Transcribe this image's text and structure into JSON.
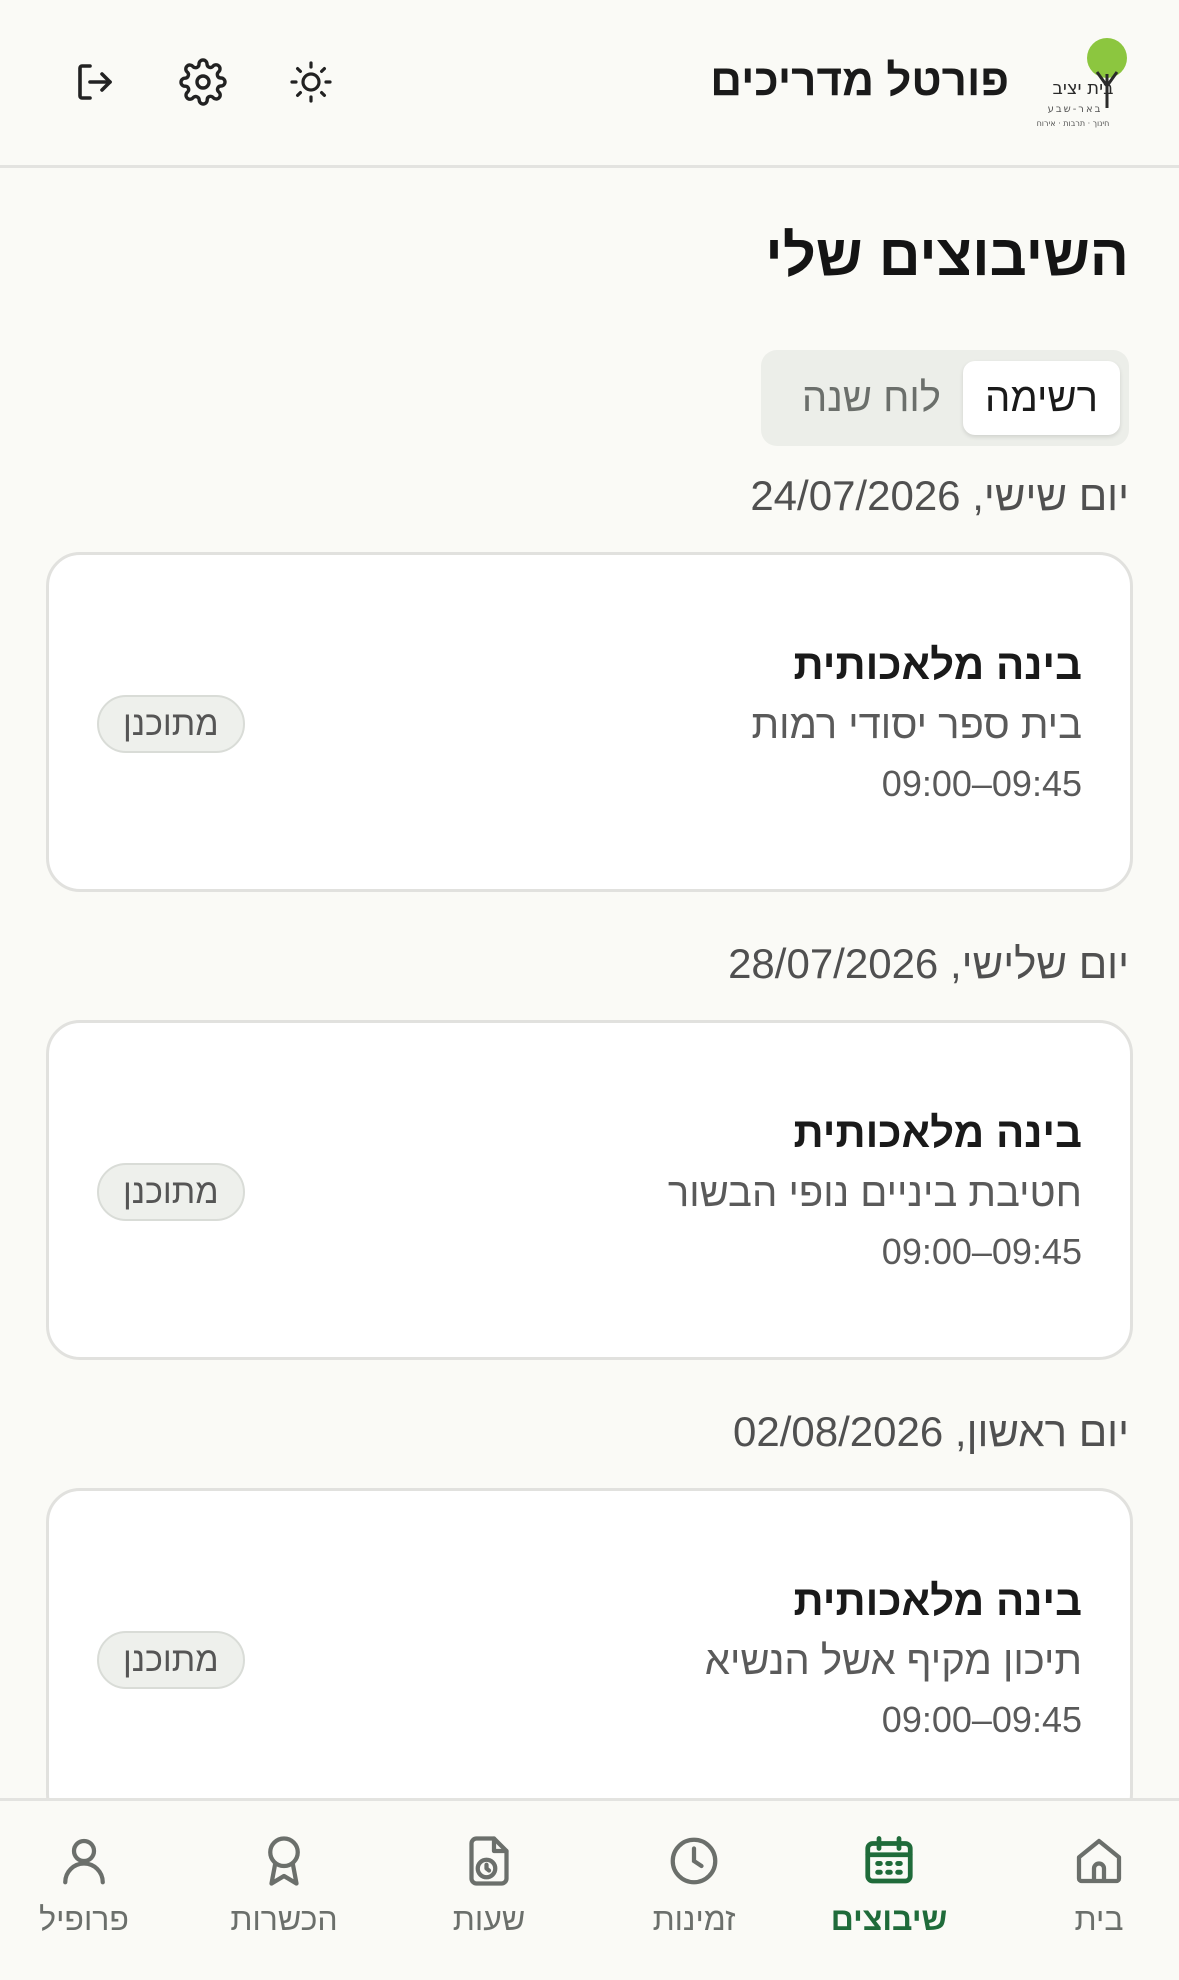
{
  "header": {
    "logo_text_main": "בית יציב",
    "logo_text_city": "באר-שבע",
    "logo_text_tagline": "חינוך · תרבות · אירוח",
    "title": "פורטל מדריכים",
    "icons": [
      "logout-icon",
      "gear-icon",
      "sun-icon"
    ]
  },
  "page": {
    "title": "השיבוצים שלי",
    "view_toggle": {
      "options": [
        "רשימה",
        "לוח שנה"
      ],
      "selected": "רשימה"
    }
  },
  "assignments": [
    {
      "date": "יום שישי, 24/07/2026",
      "title": "בינה מלאכותית",
      "school": "בית ספר יסודי רמות",
      "time": "09:00–09:45",
      "status": "מתוכנן"
    },
    {
      "date": "יום שלישי, 28/07/2026",
      "title": "בינה מלאכותית",
      "school": "חטיבת ביניים נופי הבשור",
      "time": "09:00–09:45",
      "status": "מתוכנן"
    },
    {
      "date": "יום ראשון, 02/08/2026",
      "title": "בינה מלאכותית",
      "school": "תיכון מקיף אשל הנשיא",
      "time": "09:00–09:45",
      "status": "מתוכנן"
    }
  ],
  "bottom_nav": {
    "items": [
      {
        "label": "בית",
        "icon": "home-icon"
      },
      {
        "label": "שיבוצים",
        "icon": "calendar-icon"
      },
      {
        "label": "זמינות",
        "icon": "clock-icon"
      },
      {
        "label": "שעות",
        "icon": "timesheet-icon"
      },
      {
        "label": "הכשרות",
        "icon": "award-icon"
      },
      {
        "label": "פרופיל",
        "icon": "user-icon"
      }
    ],
    "active": "שיבוצים"
  },
  "colors": {
    "background": "#fafaf6",
    "accent_green": "#1f6b3a",
    "logo_green": "#8cc63f",
    "card_border": "#e1e1de",
    "muted_text": "#6b6f6b"
  }
}
